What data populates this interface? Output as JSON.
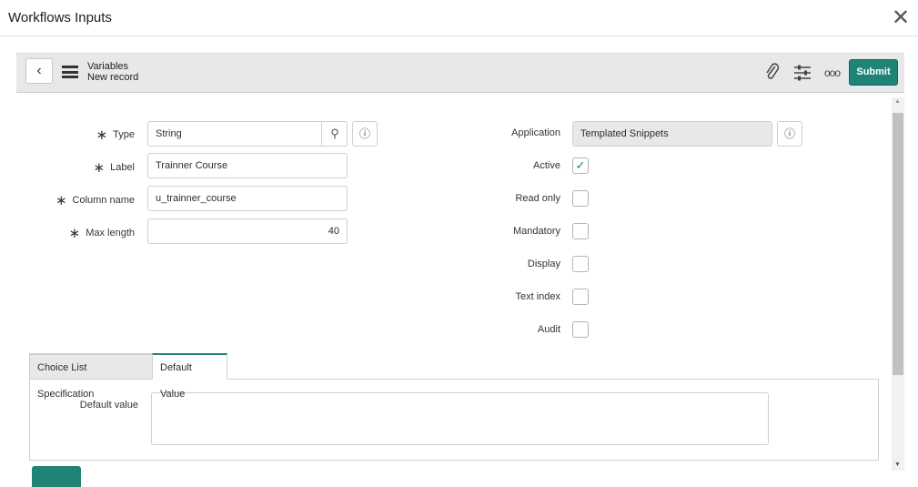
{
  "window": {
    "title": "Workflows Inputs",
    "close": "✕"
  },
  "header": {
    "title": "Variables",
    "subtitle": "New record",
    "submit": "Submit"
  },
  "left_fields": [
    {
      "label": "Type",
      "value": "String"
    },
    {
      "label": "Label",
      "value": "Trainner Course"
    },
    {
      "label": "Column name",
      "value": "u_trainner_course"
    },
    {
      "label": "Max length",
      "value": "40"
    }
  ],
  "application": {
    "label": "Application",
    "value": "Templated Snippets"
  },
  "checkboxes": [
    {
      "label": "Active",
      "checked": true
    },
    {
      "label": "Read only",
      "checked": false
    },
    {
      "label": "Mandatory",
      "checked": false
    },
    {
      "label": "Display",
      "checked": false
    },
    {
      "label": "Text index",
      "checked": false
    },
    {
      "label": "Audit",
      "checked": false
    }
  ],
  "tabs": [
    {
      "label": "Choice List Specification"
    },
    {
      "label": "Default Value"
    }
  ],
  "default_value": {
    "label": "Default value",
    "value": ""
  },
  "colors": {
    "accent": "#1f8476"
  }
}
